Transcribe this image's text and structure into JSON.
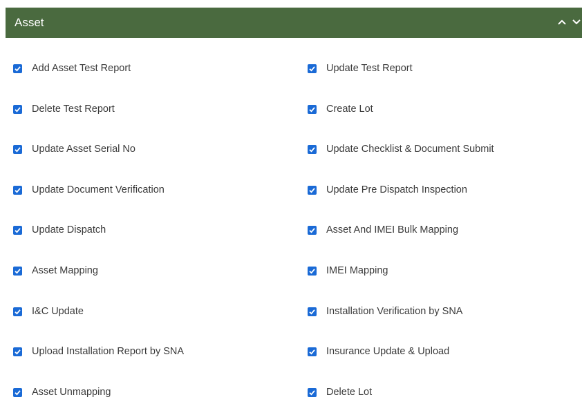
{
  "header": {
    "title": "Asset"
  },
  "left_items": [
    "Add Asset Test Report",
    "Delete Test Report",
    "Update Asset Serial No",
    "Update Document Verification",
    "Update Dispatch",
    "Asset Mapping",
    "I&C Update",
    "Upload Installation Report by SNA",
    "Asset Unmapping"
  ],
  "right_items": [
    "Update Test Report",
    "Create Lot",
    "Update Checklist & Document Submit",
    "Update Pre Dispatch Inspection",
    "Asset And IMEI Bulk Mapping",
    "IMEI Mapping",
    "Installation Verification by SNA",
    "Insurance Update & Upload",
    "Delete Lot"
  ],
  "checked": true,
  "colors": {
    "header_bg": "#4a6a3f",
    "checkbox": "#1a6ad6"
  }
}
